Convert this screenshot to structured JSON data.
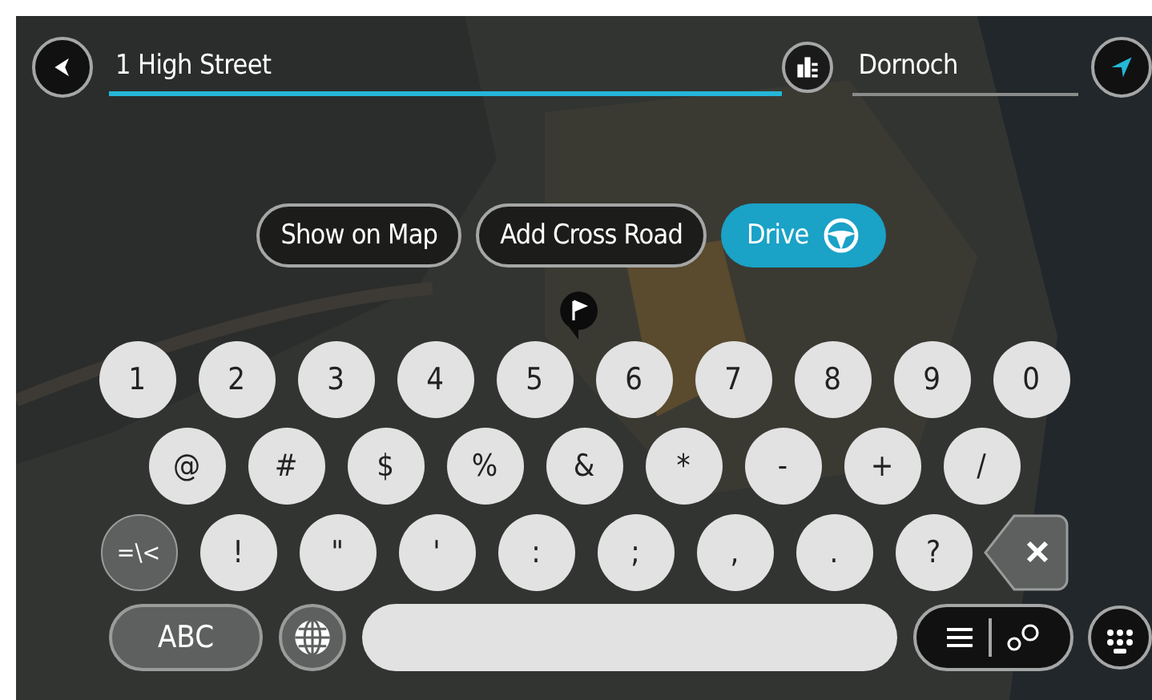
{
  "search": {
    "street_field": {
      "value": "1 High Street",
      "focused": true
    },
    "city_field": {
      "value": "Dornoch",
      "focused": false
    }
  },
  "actions": [
    {
      "label": "Show on Map",
      "kind": "outline"
    },
    {
      "label": "Add Cross Road",
      "kind": "outline"
    },
    {
      "label": "Drive",
      "kind": "primary"
    }
  ],
  "keyboard": {
    "rows": [
      [
        {
          "kind": "char",
          "label": "1"
        },
        {
          "kind": "char",
          "label": "2"
        },
        {
          "kind": "char",
          "label": "3"
        },
        {
          "kind": "char",
          "label": "4"
        },
        {
          "kind": "char",
          "label": "5"
        },
        {
          "kind": "char",
          "label": "6"
        },
        {
          "kind": "char",
          "label": "7"
        },
        {
          "kind": "char",
          "label": "8"
        },
        {
          "kind": "char",
          "label": "9"
        },
        {
          "kind": "char",
          "label": "0"
        }
      ],
      [
        {
          "kind": "char",
          "label": "@"
        },
        {
          "kind": "char",
          "label": "#"
        },
        {
          "kind": "char",
          "label": "$"
        },
        {
          "kind": "char",
          "label": "%"
        },
        {
          "kind": "char",
          "label": "&"
        },
        {
          "kind": "char",
          "label": "*"
        },
        {
          "kind": "char",
          "label": "-"
        },
        {
          "kind": "char",
          "label": "+"
        },
        {
          "kind": "char",
          "label": "/"
        }
      ],
      [
        {
          "kind": "mode",
          "label": "=\\<"
        },
        {
          "kind": "char",
          "label": "!"
        },
        {
          "kind": "char",
          "label": "\""
        },
        {
          "kind": "char",
          "label": "'"
        },
        {
          "kind": "char",
          "label": ":"
        },
        {
          "kind": "char",
          "label": ";"
        },
        {
          "kind": "char",
          "label": ","
        },
        {
          "kind": "char",
          "label": "."
        },
        {
          "kind": "char",
          "label": "?"
        },
        {
          "kind": "backspace"
        }
      ],
      [
        {
          "kind": "abc",
          "label": "ABC"
        },
        {
          "kind": "globe"
        },
        {
          "kind": "space"
        },
        {
          "kind": "toggle",
          "options": [
            {
              "kind": "list",
              "selected": false
            },
            {
              "kind": "map",
              "selected": false
            }
          ]
        },
        {
          "kind": "hide"
        }
      ]
    ]
  }
}
